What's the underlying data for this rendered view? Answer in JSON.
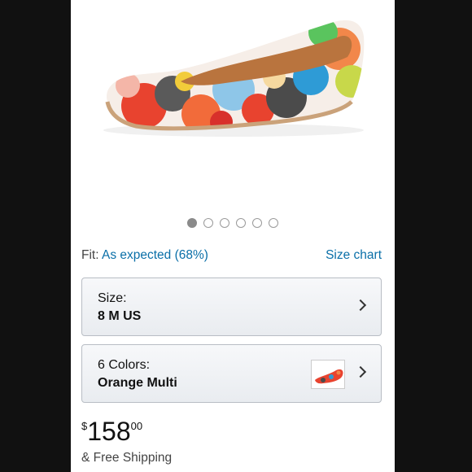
{
  "gallery": {
    "dot_count": 6,
    "active_index": 0
  },
  "fit": {
    "label": "Fit:",
    "value": "As expected (68%)",
    "size_chart": "Size chart"
  },
  "size_selector": {
    "label": "Size:",
    "value": "8 M US"
  },
  "color_selector": {
    "label": "6 Colors:",
    "value": "Orange Multi"
  },
  "price": {
    "currency": "$",
    "whole": "158",
    "fraction": "00"
  },
  "shipping": "& Free Shipping",
  "colors": {
    "link": "#0a6fa8",
    "background": "#111111"
  }
}
